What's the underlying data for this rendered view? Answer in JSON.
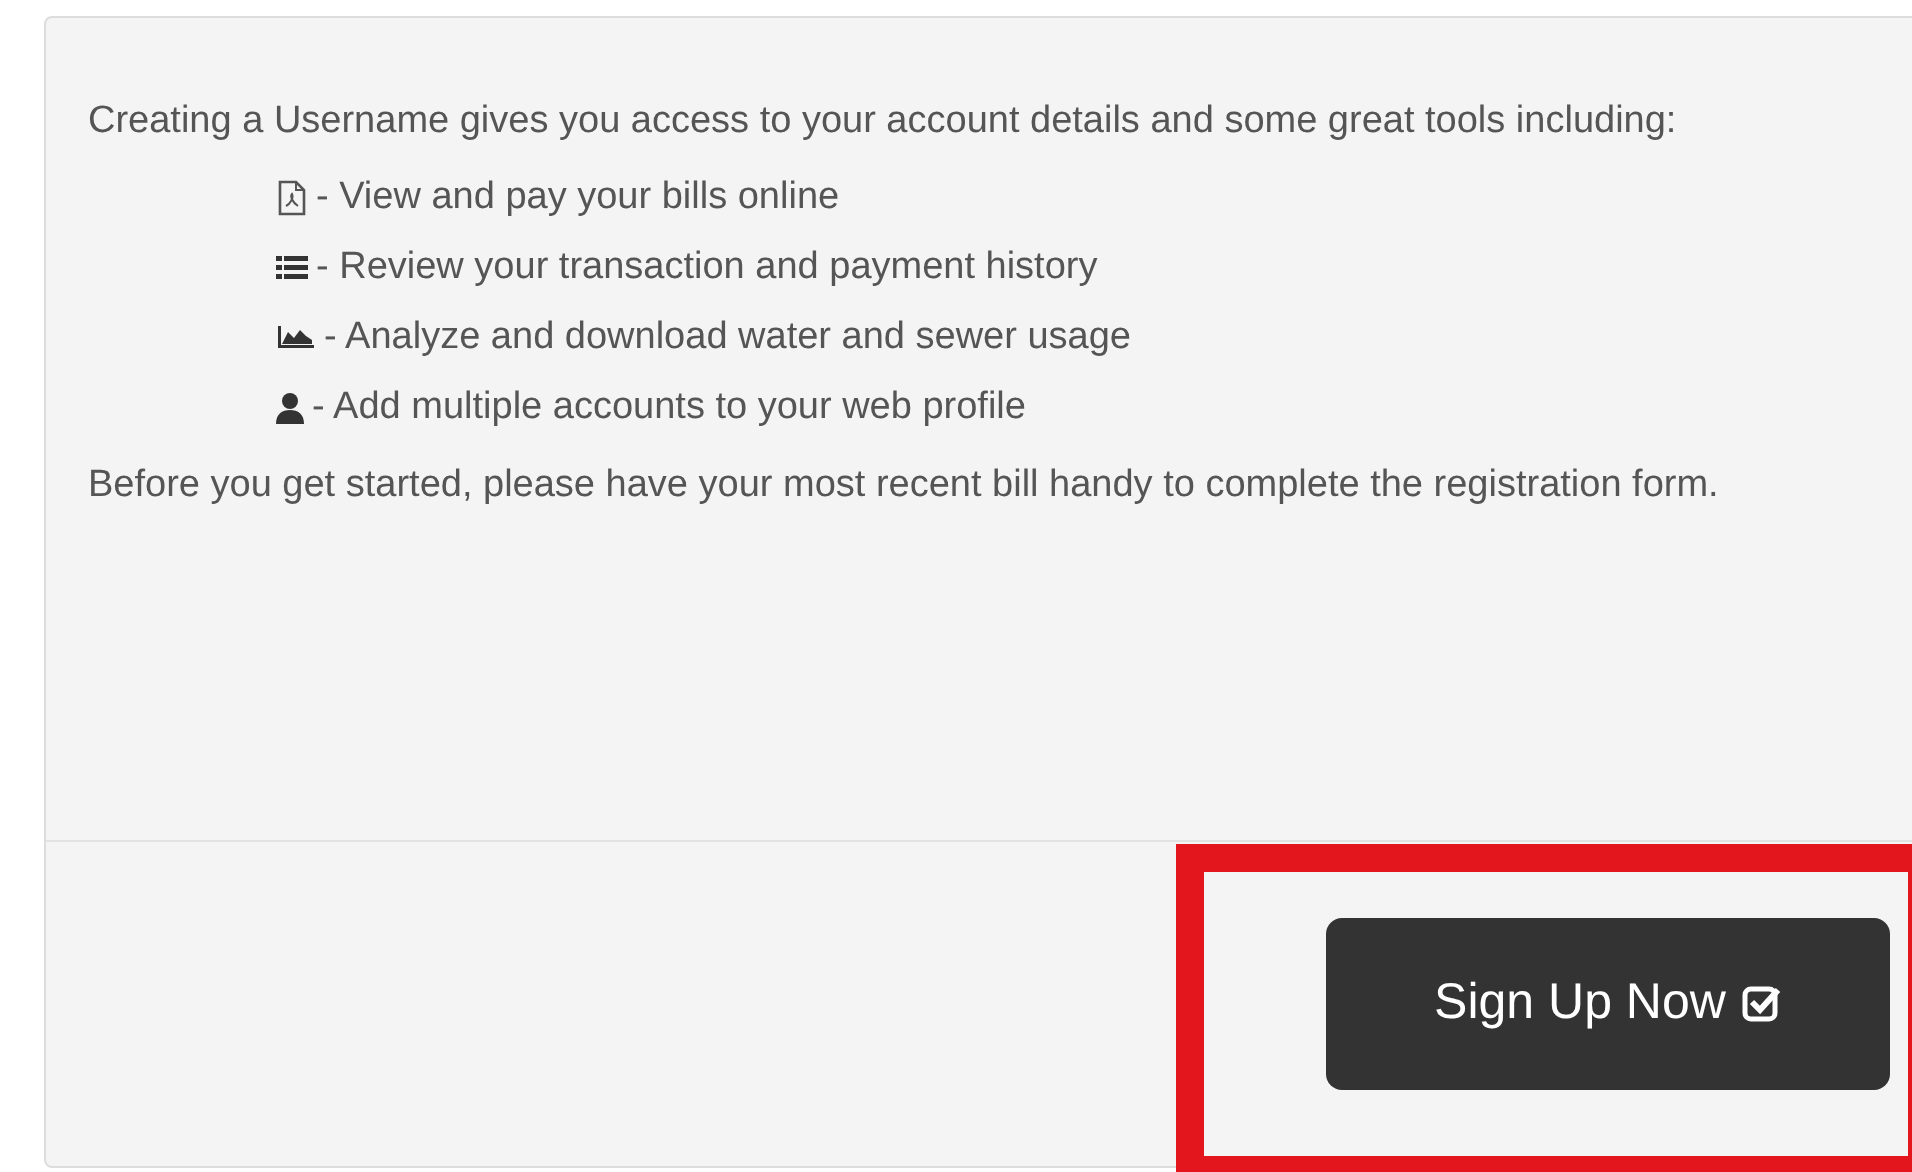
{
  "intro": "Creating a Username gives you access to your account details and some great tools including:",
  "features": [
    {
      "text": "- View and pay your bills online"
    },
    {
      "text": "- Review your transaction and payment history"
    },
    {
      "text": "- Analyze and download water and sewer usage"
    },
    {
      "text": "- Add multiple accounts to your web profile"
    }
  ],
  "note": "Before you get started, please have your most recent bill handy to complete the registration form.",
  "button": {
    "label": "Sign Up Now",
    "highlighted": true
  }
}
